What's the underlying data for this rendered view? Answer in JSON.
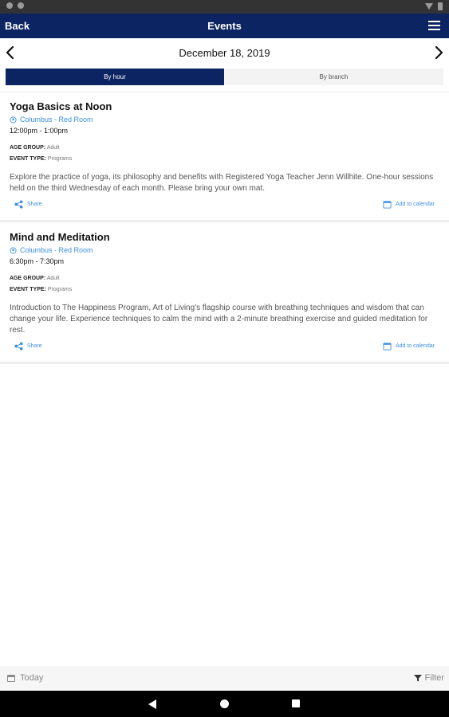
{
  "app_bar": {
    "back_label": "Back",
    "title": "Events"
  },
  "date_nav": {
    "date": "December 18, 2019"
  },
  "view_toggle": {
    "by_hour": "By hour",
    "by_branch": "By branch"
  },
  "events": [
    {
      "title": "Yoga Basics at Noon",
      "location": "Columbus - Red Room",
      "time": "12:00pm - 1:00pm",
      "age_group_label": "AGE GROUP:",
      "age_group": "Adult",
      "event_type_label": "EVENT TYPE:",
      "event_type": "Programs",
      "description": "Explore the practice of yoga, its philosophy and benefits with Registered Yoga Teacher Jenn Willhite. One-hour sessions held on the third Wednesday of each month. Please bring your own mat.",
      "share_label": "Share",
      "add_calendar_label": "Add to calendar"
    },
    {
      "title": "Mind and Meditation",
      "location": "Columbus - Red Room",
      "time": "6:30pm - 7:30pm",
      "age_group_label": "AGE GROUP:",
      "age_group": "Adult",
      "event_type_label": "EVENT TYPE:",
      "event_type": "Programs",
      "description": "Introduction to The Happiness Program, Art of Living's flagship course with breathing techniques and wisdom that can change your life. Experience techniques to calm the mind with a 2-minute breathing exercise and guided meditation for rest.",
      "share_label": "Share",
      "add_calendar_label": "Add to calendar"
    }
  ],
  "footer": {
    "today_label": "Today",
    "filter_label": "Filter"
  },
  "colors": {
    "primary": "#0c2461",
    "link": "#3d8fe0"
  },
  "icons": [
    "menu-icon",
    "chevron-left-icon",
    "chevron-right-icon",
    "location-pin-icon",
    "share-icon",
    "calendar-icon",
    "filter-icon"
  ]
}
